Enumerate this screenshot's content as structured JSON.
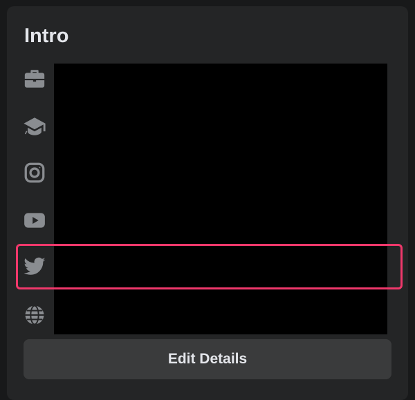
{
  "intro": {
    "title": "Intro",
    "edit_button_label": "Edit Details"
  },
  "icons": [
    {
      "name": "briefcase-icon",
      "meaning": "work"
    },
    {
      "name": "graduation-cap-icon",
      "meaning": "education"
    },
    {
      "name": "instagram-icon",
      "meaning": "instagram"
    },
    {
      "name": "youtube-icon",
      "meaning": "youtube"
    },
    {
      "name": "twitter-icon",
      "meaning": "twitter"
    },
    {
      "name": "globe-icon",
      "meaning": "website"
    }
  ],
  "colors": {
    "page_background": "#18191a",
    "card_background": "#242526",
    "icon_color": "#8a8d91",
    "text_primary": "#e4e6eb",
    "button_background": "#3a3b3c",
    "highlight_border": "#f0386b",
    "redaction": "#000000"
  }
}
